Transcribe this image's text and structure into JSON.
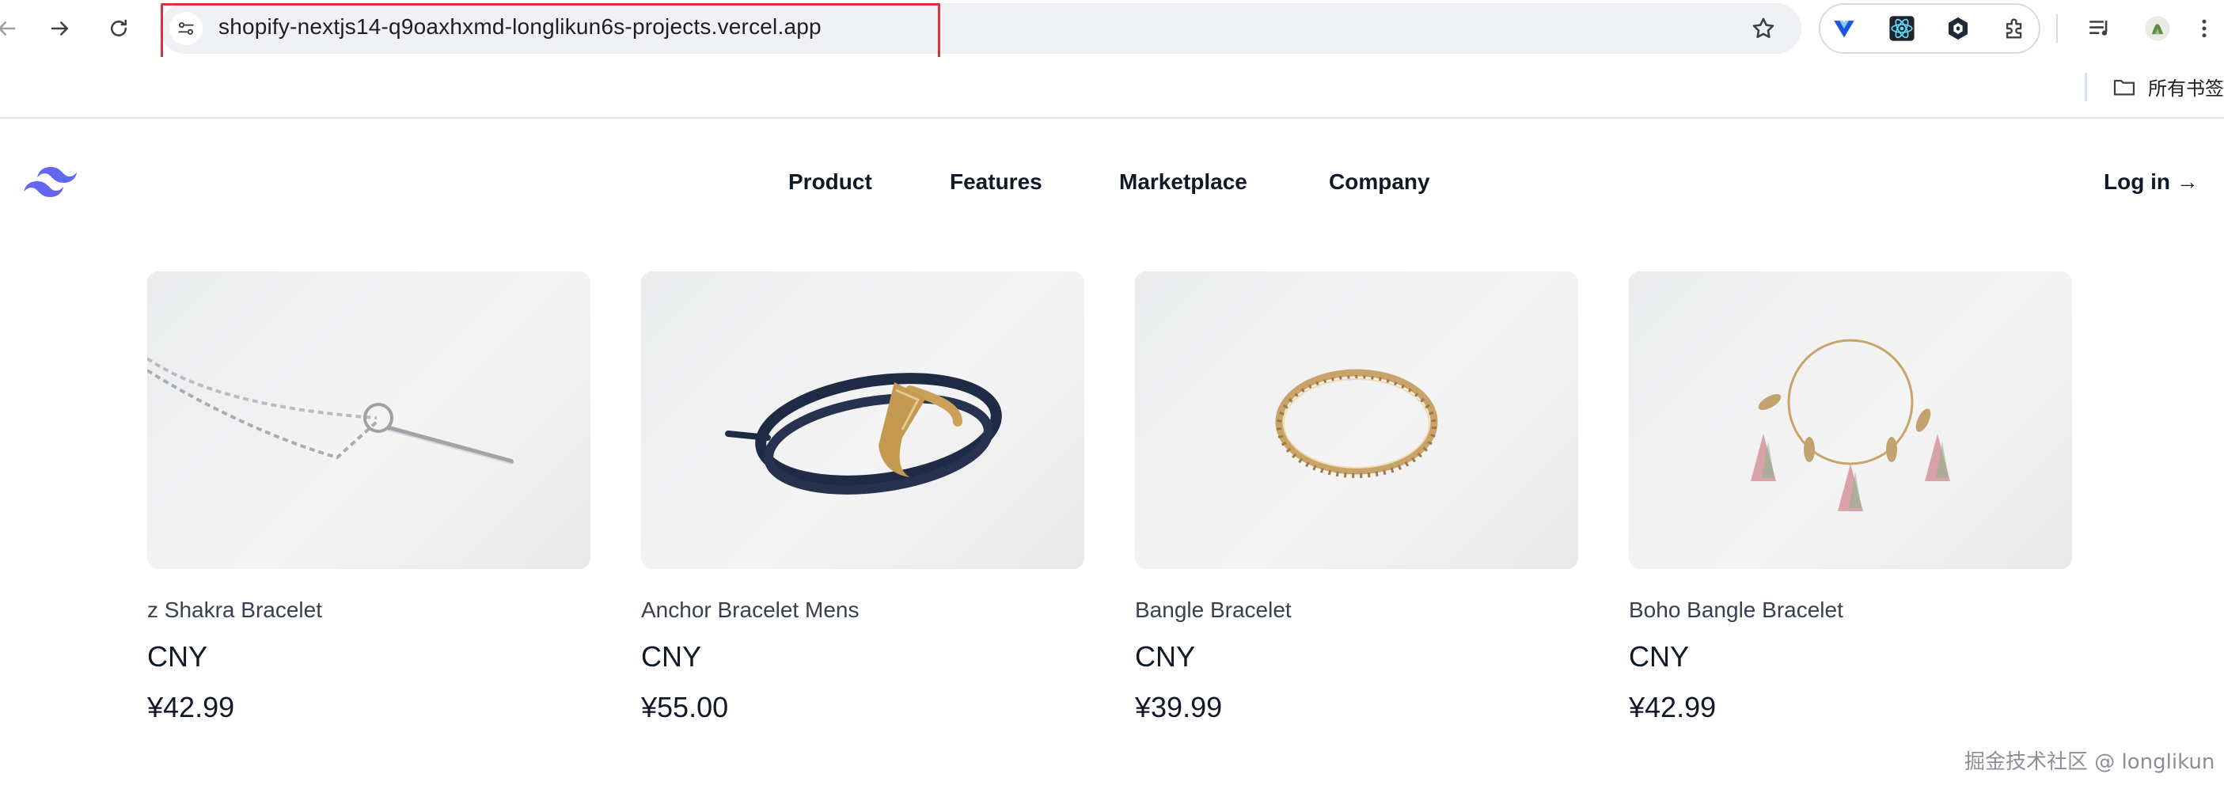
{
  "browser": {
    "url": "shopify-nextjs14-q9oaxhxmd-longlikun6s-projects.vercel.app",
    "bookmarks_folder": "所有书签"
  },
  "site": {
    "nav": [
      "Product",
      "Features",
      "Marketplace",
      "Company"
    ],
    "login": "Log in →",
    "brand_color": "#6366f1"
  },
  "products": [
    {
      "name": "z Shakra Bracelet",
      "currency": "CNY",
      "price": "¥42.99",
      "image": "silver-chain-bracelet"
    },
    {
      "name": "Anchor Bracelet Mens",
      "currency": "CNY",
      "price": "¥55.00",
      "image": "anchor-leather-bracelet"
    },
    {
      "name": "Bangle Bracelet",
      "currency": "CNY",
      "price": "¥39.99",
      "image": "gold-bangle"
    },
    {
      "name": "Boho Bangle Bracelet",
      "currency": "CNY",
      "price": "¥42.99",
      "image": "tassel-bangle"
    }
  ],
  "watermark": "掘金技术社区 @ longlikun",
  "colors": {
    "url_highlight": "#e0313b",
    "omnibox": "#eff1f5"
  }
}
